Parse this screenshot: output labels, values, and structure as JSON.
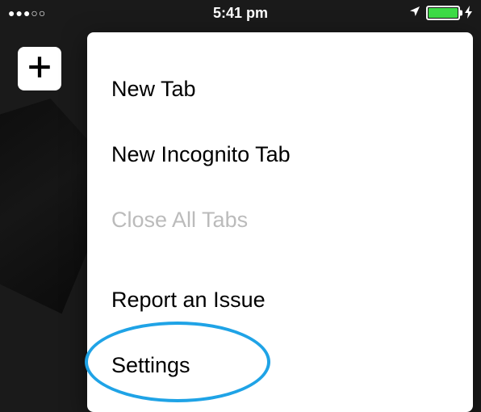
{
  "status_bar": {
    "time": "5:41 pm"
  },
  "menu": {
    "new_tab": "New Tab",
    "new_incognito_tab": "New Incognito Tab",
    "close_all_tabs": "Close All Tabs",
    "report_issue": "Report an Issue",
    "settings": "Settings"
  }
}
